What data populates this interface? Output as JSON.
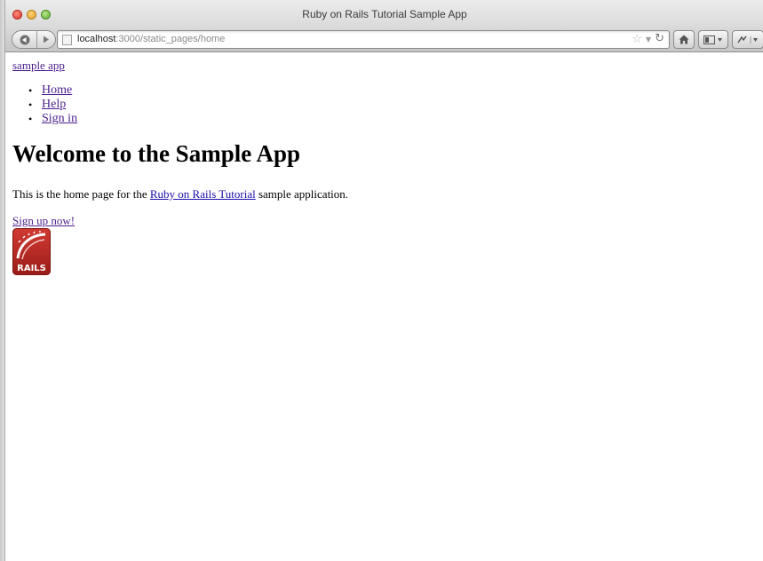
{
  "browser": {
    "window_title": "Ruby on Rails Tutorial Sample App",
    "url_host": "localhost",
    "url_rest": ":3000/static_pages/home",
    "icons": {
      "back": "back-arrow-icon",
      "forward": "forward-arrow-icon",
      "star": "star-icon",
      "reload": "reload-icon",
      "home": "home-icon",
      "bookmarks": "bookmarks-icon"
    }
  },
  "page": {
    "logo_text": "sample app",
    "nav": [
      "Home",
      "Help",
      "Sign in"
    ],
    "heading": "Welcome to the Sample App",
    "intro_before": "This is the home page for the ",
    "intro_link": "Ruby on Rails Tutorial",
    "intro_after": " sample application.",
    "signup_link": "Sign up now!",
    "logo_badge": "RAILS"
  },
  "colors": {
    "link": "#1a0dab",
    "visited_link": "#4b1f8c",
    "rails_red": "#b0231f"
  }
}
